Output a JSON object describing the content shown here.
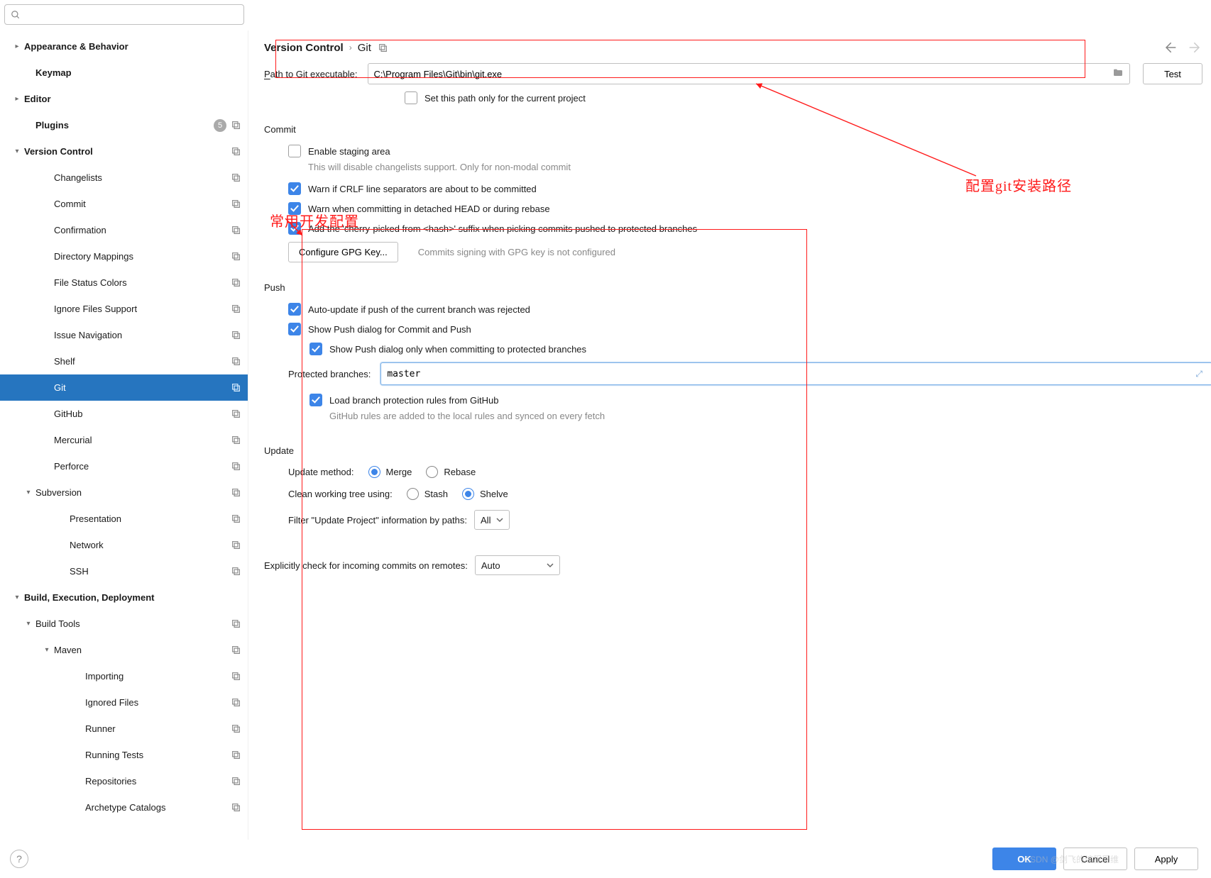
{
  "search": {
    "placeholder": ""
  },
  "sidebar": {
    "items": [
      {
        "label": "Appearance & Behavior",
        "bold": true,
        "arrow": "right",
        "indent": 0
      },
      {
        "label": "Keymap",
        "bold": true,
        "indent": 1
      },
      {
        "label": "Editor",
        "bold": true,
        "arrow": "right",
        "indent": 0
      },
      {
        "label": "Plugins",
        "bold": true,
        "indent": 1,
        "badge": "5",
        "popup": true
      },
      {
        "label": "Version Control",
        "bold": true,
        "arrow": "down",
        "indent": 0,
        "popup": true
      },
      {
        "label": "Changelists",
        "indent": 2,
        "popup": true
      },
      {
        "label": "Commit",
        "indent": 2,
        "popup": true
      },
      {
        "label": "Confirmation",
        "indent": 2,
        "popup": true
      },
      {
        "label": "Directory Mappings",
        "indent": 2,
        "popup": true
      },
      {
        "label": "File Status Colors",
        "indent": 2,
        "popup": true
      },
      {
        "label": "Ignore Files Support",
        "indent": 2,
        "popup": true
      },
      {
        "label": "Issue Navigation",
        "indent": 2,
        "popup": true
      },
      {
        "label": "Shelf",
        "indent": 2,
        "popup": true
      },
      {
        "label": "Git",
        "indent": 2,
        "popup": true,
        "selected": true
      },
      {
        "label": "GitHub",
        "indent": 2,
        "popup": true
      },
      {
        "label": "Mercurial",
        "indent": 2,
        "popup": true
      },
      {
        "label": "Perforce",
        "indent": 2,
        "popup": true
      },
      {
        "label": "Subversion",
        "arrow": "down",
        "indent": 1,
        "popup": true
      },
      {
        "label": "Presentation",
        "indent": 3,
        "popup": true
      },
      {
        "label": "Network",
        "indent": 3,
        "popup": true
      },
      {
        "label": "SSH",
        "indent": 3,
        "popup": true
      },
      {
        "label": "Build, Execution, Deployment",
        "bold": true,
        "arrow": "down",
        "indent": 0
      },
      {
        "label": "Build Tools",
        "arrow": "down",
        "indent": 1,
        "popup": true
      },
      {
        "label": "Maven",
        "arrow": "down",
        "indent": 2,
        "popup": true
      },
      {
        "label": "Importing",
        "indent": 4,
        "popup": true
      },
      {
        "label": "Ignored Files",
        "indent": 4,
        "popup": true
      },
      {
        "label": "Runner",
        "indent": 4,
        "popup": true
      },
      {
        "label": "Running Tests",
        "indent": 4,
        "popup": true
      },
      {
        "label": "Repositories",
        "indent": 4,
        "popup": true
      },
      {
        "label": "Archetype Catalogs",
        "indent": 4,
        "popup": true
      }
    ]
  },
  "breadcrumb": {
    "root": "Version Control",
    "leaf": "Git"
  },
  "path": {
    "label": "Path to Git executable:",
    "value": "C:\\Program Files\\Git\\bin\\git.exe",
    "test_btn": "Test",
    "set_current": "Set this path only for the current project"
  },
  "commit": {
    "title": "Commit",
    "enable_staging": "Enable staging area",
    "enable_staging_hint": "This will disable changelists support. Only for non-modal commit",
    "warn_crlf": "Warn if CRLF line separators are about to be committed",
    "warn_detached": "Warn when committing in detached HEAD or during rebase",
    "cherry_suffix": "Add the 'cherry-picked from <hash>' suffix when picking commits pushed to protected branches",
    "gpg_btn": "Configure GPG Key...",
    "gpg_hint": "Commits signing with GPG key is not configured"
  },
  "push": {
    "title": "Push",
    "auto_update": "Auto-update if push of the current branch was rejected",
    "show_dialog": "Show Push dialog for Commit and Push",
    "show_dialog_protected": "Show Push dialog only when committing to protected branches",
    "protected_label": "Protected branches:",
    "protected_value": "master",
    "load_rules": "Load branch protection rules from GitHub",
    "load_rules_hint": "GitHub rules are added to the local rules and synced on every fetch"
  },
  "update": {
    "title": "Update",
    "method_label": "Update method:",
    "merge": "Merge",
    "rebase": "Rebase",
    "clean_label": "Clean working tree using:",
    "stash": "Stash",
    "shelve": "Shelve",
    "filter_label": "Filter \"Update Project\" information by paths:",
    "filter_value": "All"
  },
  "incoming": {
    "label": "Explicitly check for incoming commits on remotes:",
    "value": "Auto"
  },
  "footer": {
    "ok": "OK",
    "cancel": "Cancel",
    "apply": "Apply"
  },
  "annotations": {
    "config_path": "配置git安装路径",
    "dev_config": "常用开发配置"
  },
  "watermark": "CSDN @剑飞的编程思维"
}
